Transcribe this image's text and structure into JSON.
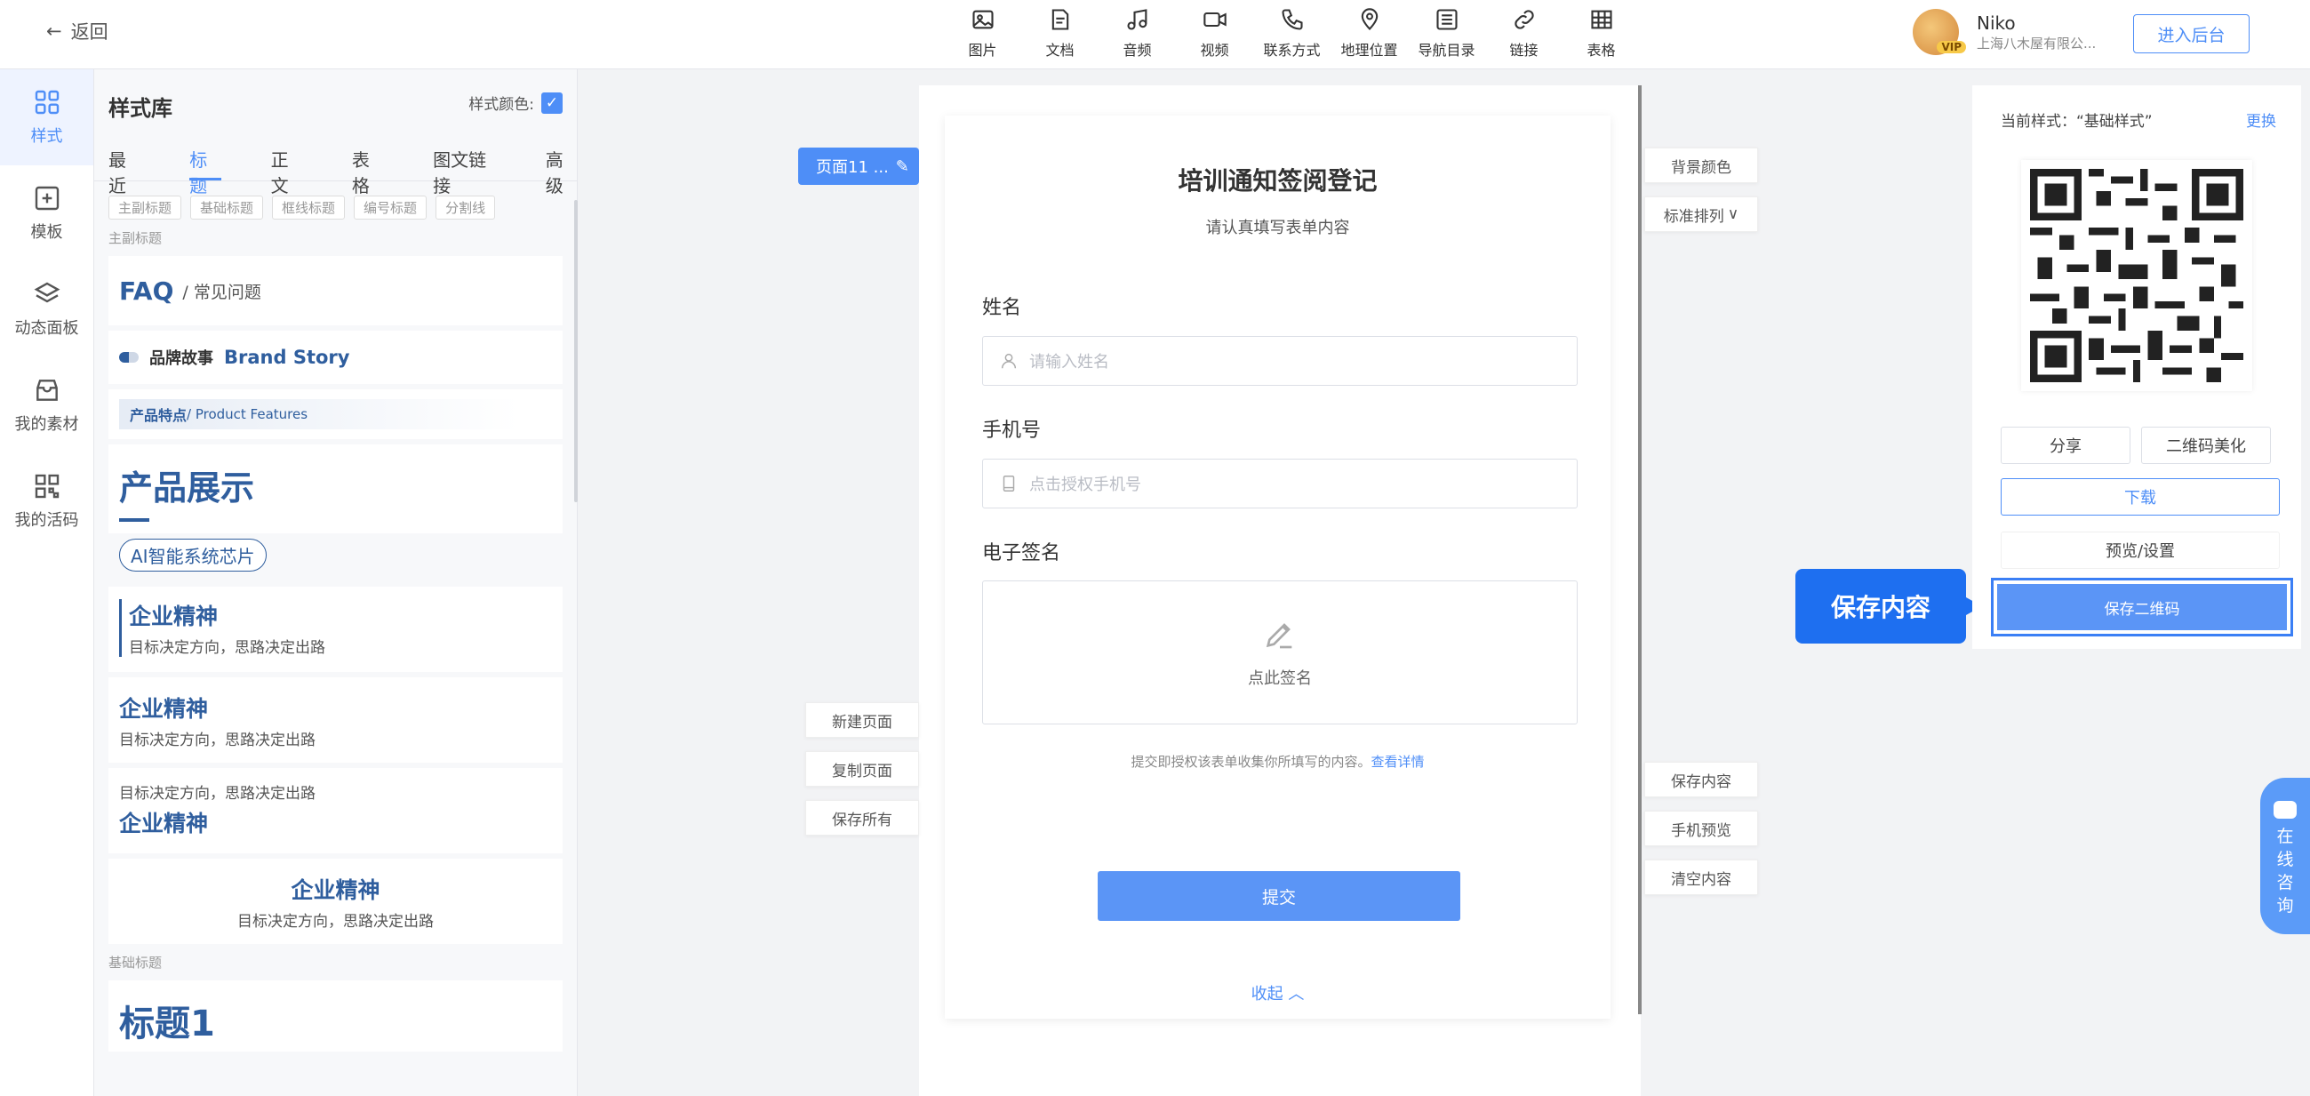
{
  "topbar": {
    "back_label": "返回",
    "tools": [
      {
        "icon": "image-icon",
        "label": "图片"
      },
      {
        "icon": "document-icon",
        "label": "文档"
      },
      {
        "icon": "music-icon",
        "label": "音频"
      },
      {
        "icon": "video-icon",
        "label": "视频"
      },
      {
        "icon": "phone-icon",
        "label": "联系方式"
      },
      {
        "icon": "location-icon",
        "label": "地理位置"
      },
      {
        "icon": "list-icon",
        "label": "导航目录"
      },
      {
        "icon": "link-icon",
        "label": "链接"
      },
      {
        "icon": "table-icon",
        "label": "表格"
      }
    ],
    "user": {
      "name": "Niko",
      "company": "上海八木屋有限公...",
      "badge": "VIP"
    },
    "backend_button": "进入后台"
  },
  "rail": [
    {
      "icon": "style-icon",
      "label": "样式",
      "active": true
    },
    {
      "icon": "template-icon",
      "label": "模板",
      "active": false
    },
    {
      "icon": "layers-icon",
      "label": "动态面板",
      "active": false
    },
    {
      "icon": "box-icon",
      "label": "我的素材",
      "active": false
    },
    {
      "icon": "qrcode-icon",
      "label": "我的活码",
      "active": false
    }
  ],
  "library": {
    "title": "样式库",
    "color_label": "样式颜色:",
    "tabs": [
      "最近",
      "标题",
      "正文",
      "表格",
      "图文链接",
      "高级"
    ],
    "active_tab": 1,
    "chips": [
      "主副标题",
      "基础标题",
      "框线标题",
      "编号标题",
      "分割线"
    ],
    "section_main": "主副标题",
    "faq_main": "FAQ",
    "faq_sub": "/ 常见问题",
    "brand_cn": "品牌故事",
    "brand_en": "Brand Story",
    "features_cn": "产品特点",
    "features_en": "/ Product Features",
    "showcase": "产品展示",
    "chip_title": "AI智能系统芯片",
    "spirit": "企业精神",
    "spirit_sub": "目标决定方向，思路决定出路",
    "section_basic": "基础标题",
    "basic_title": "标题1"
  },
  "canvas": {
    "page_tab": "页面11 ...",
    "form_title": "培训通知签阅登记",
    "form_subtitle": "请认真填写表单内容",
    "name_label": "姓名",
    "name_placeholder": "请输入姓名",
    "phone_label": "手机号",
    "phone_placeholder": "点击授权手机号",
    "sign_label": "电子签名",
    "sign_hint": "点此签名",
    "notice_text": "提交即授权该表单收集你所填写的内容。",
    "notice_link": "查看详情",
    "submit": "提交",
    "collapse": "收起"
  },
  "left_actions": [
    "新建页面",
    "复制页面",
    "保存所有"
  ],
  "right_top_actions": [
    "背景颜色",
    "标准排列"
  ],
  "right_bottom_actions": [
    "保存内容",
    "手机预览",
    "清空内容"
  ],
  "qr_panel": {
    "current_style": "当前样式：“基础样式”",
    "change": "更换",
    "share": "分享",
    "beautify": "二维码美化",
    "download": "下载",
    "preview": "预览/设置",
    "save_qr": "保存二维码"
  },
  "callout": "保存内容",
  "consult": [
    "在",
    "线",
    "咨",
    "询"
  ]
}
